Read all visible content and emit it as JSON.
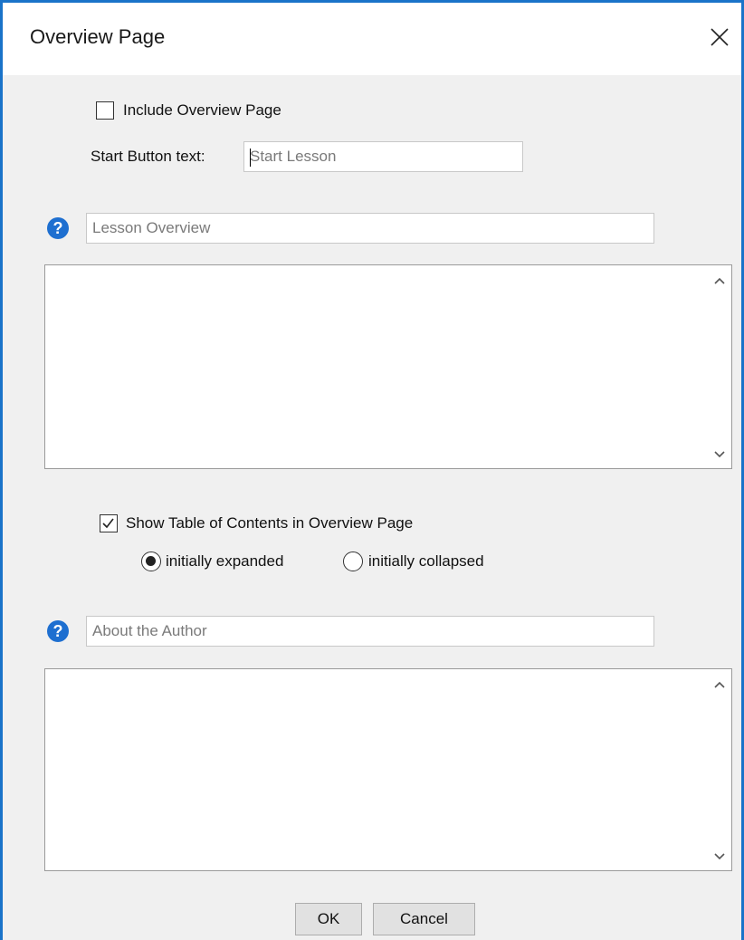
{
  "window": {
    "title": "Overview Page",
    "close_icon": "close-icon"
  },
  "overview_page": {
    "include_label": "Include Overview Page",
    "include_checked": false,
    "start_button_label": "Start Button text:",
    "start_button_placeholder": "Start Lesson",
    "start_button_value": ""
  },
  "lesson_overview": {
    "help_icon": "help-icon",
    "help_glyph": "?",
    "title_placeholder": "Lesson Overview",
    "title_value": "",
    "body_value": ""
  },
  "toc": {
    "show_label": "Show Table of Contents in Overview Page",
    "show_checked": true,
    "expanded_label": "initially expanded",
    "collapsed_label": "initially collapsed",
    "selected": "initially expanded"
  },
  "about_author": {
    "help_icon": "help-icon",
    "help_glyph": "?",
    "title_placeholder": "About the Author",
    "title_value": "",
    "body_value": ""
  },
  "buttons": {
    "ok_label": "OK",
    "cancel_label": "Cancel"
  },
  "colors": {
    "accent": "#1a73c9",
    "help_icon": "#1e6fd0",
    "dialog_bg": "#f0f0f0"
  }
}
